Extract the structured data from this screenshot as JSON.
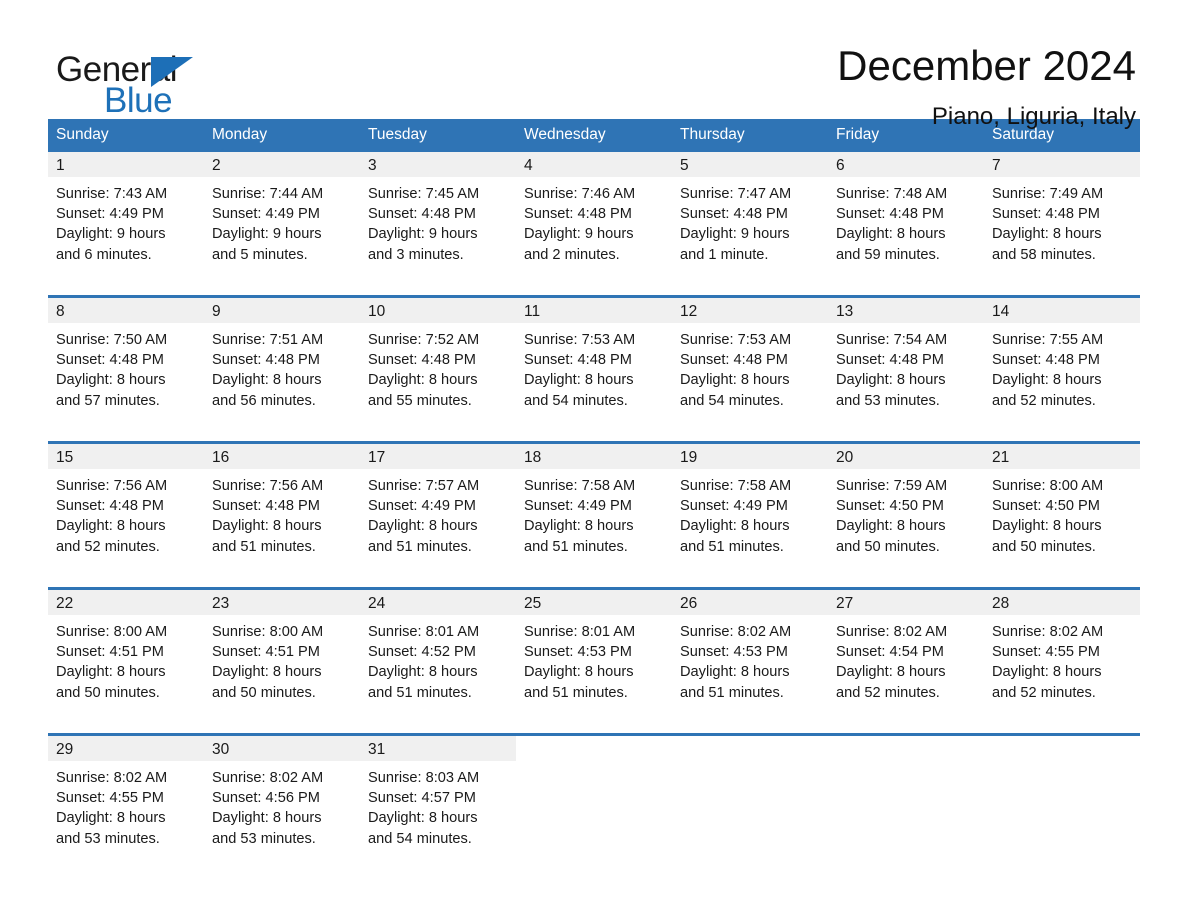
{
  "brand": {
    "name_part1": "General",
    "name_part2": "Blue",
    "triangle_icon": "triangle-icon",
    "accent_color": "#1d6fb7"
  },
  "header": {
    "title": "December 2024",
    "location": "Piano, Liguria, Italy"
  },
  "calendar": {
    "header_bg": "#2f74b5",
    "daynum_bg": "#f0f0f0",
    "weekdays": [
      "Sunday",
      "Monday",
      "Tuesday",
      "Wednesday",
      "Thursday",
      "Friday",
      "Saturday"
    ],
    "weeks": [
      [
        {
          "day": "1",
          "sunrise": "Sunrise: 7:43 AM",
          "sunset": "Sunset: 4:49 PM",
          "daylight_line1": "Daylight: 9 hours",
          "daylight_line2": "and 6 minutes."
        },
        {
          "day": "2",
          "sunrise": "Sunrise: 7:44 AM",
          "sunset": "Sunset: 4:49 PM",
          "daylight_line1": "Daylight: 9 hours",
          "daylight_line2": "and 5 minutes."
        },
        {
          "day": "3",
          "sunrise": "Sunrise: 7:45 AM",
          "sunset": "Sunset: 4:48 PM",
          "daylight_line1": "Daylight: 9 hours",
          "daylight_line2": "and 3 minutes."
        },
        {
          "day": "4",
          "sunrise": "Sunrise: 7:46 AM",
          "sunset": "Sunset: 4:48 PM",
          "daylight_line1": "Daylight: 9 hours",
          "daylight_line2": "and 2 minutes."
        },
        {
          "day": "5",
          "sunrise": "Sunrise: 7:47 AM",
          "sunset": "Sunset: 4:48 PM",
          "daylight_line1": "Daylight: 9 hours",
          "daylight_line2": "and 1 minute."
        },
        {
          "day": "6",
          "sunrise": "Sunrise: 7:48 AM",
          "sunset": "Sunset: 4:48 PM",
          "daylight_line1": "Daylight: 8 hours",
          "daylight_line2": "and 59 minutes."
        },
        {
          "day": "7",
          "sunrise": "Sunrise: 7:49 AM",
          "sunset": "Sunset: 4:48 PM",
          "daylight_line1": "Daylight: 8 hours",
          "daylight_line2": "and 58 minutes."
        }
      ],
      [
        {
          "day": "8",
          "sunrise": "Sunrise: 7:50 AM",
          "sunset": "Sunset: 4:48 PM",
          "daylight_line1": "Daylight: 8 hours",
          "daylight_line2": "and 57 minutes."
        },
        {
          "day": "9",
          "sunrise": "Sunrise: 7:51 AM",
          "sunset": "Sunset: 4:48 PM",
          "daylight_line1": "Daylight: 8 hours",
          "daylight_line2": "and 56 minutes."
        },
        {
          "day": "10",
          "sunrise": "Sunrise: 7:52 AM",
          "sunset": "Sunset: 4:48 PM",
          "daylight_line1": "Daylight: 8 hours",
          "daylight_line2": "and 55 minutes."
        },
        {
          "day": "11",
          "sunrise": "Sunrise: 7:53 AM",
          "sunset": "Sunset: 4:48 PM",
          "daylight_line1": "Daylight: 8 hours",
          "daylight_line2": "and 54 minutes."
        },
        {
          "day": "12",
          "sunrise": "Sunrise: 7:53 AM",
          "sunset": "Sunset: 4:48 PM",
          "daylight_line1": "Daylight: 8 hours",
          "daylight_line2": "and 54 minutes."
        },
        {
          "day": "13",
          "sunrise": "Sunrise: 7:54 AM",
          "sunset": "Sunset: 4:48 PM",
          "daylight_line1": "Daylight: 8 hours",
          "daylight_line2": "and 53 minutes."
        },
        {
          "day": "14",
          "sunrise": "Sunrise: 7:55 AM",
          "sunset": "Sunset: 4:48 PM",
          "daylight_line1": "Daylight: 8 hours",
          "daylight_line2": "and 52 minutes."
        }
      ],
      [
        {
          "day": "15",
          "sunrise": "Sunrise: 7:56 AM",
          "sunset": "Sunset: 4:48 PM",
          "daylight_line1": "Daylight: 8 hours",
          "daylight_line2": "and 52 minutes."
        },
        {
          "day": "16",
          "sunrise": "Sunrise: 7:56 AM",
          "sunset": "Sunset: 4:48 PM",
          "daylight_line1": "Daylight: 8 hours",
          "daylight_line2": "and 51 minutes."
        },
        {
          "day": "17",
          "sunrise": "Sunrise: 7:57 AM",
          "sunset": "Sunset: 4:49 PM",
          "daylight_line1": "Daylight: 8 hours",
          "daylight_line2": "and 51 minutes."
        },
        {
          "day": "18",
          "sunrise": "Sunrise: 7:58 AM",
          "sunset": "Sunset: 4:49 PM",
          "daylight_line1": "Daylight: 8 hours",
          "daylight_line2": "and 51 minutes."
        },
        {
          "day": "19",
          "sunrise": "Sunrise: 7:58 AM",
          "sunset": "Sunset: 4:49 PM",
          "daylight_line1": "Daylight: 8 hours",
          "daylight_line2": "and 51 minutes."
        },
        {
          "day": "20",
          "sunrise": "Sunrise: 7:59 AM",
          "sunset": "Sunset: 4:50 PM",
          "daylight_line1": "Daylight: 8 hours",
          "daylight_line2": "and 50 minutes."
        },
        {
          "day": "21",
          "sunrise": "Sunrise: 8:00 AM",
          "sunset": "Sunset: 4:50 PM",
          "daylight_line1": "Daylight: 8 hours",
          "daylight_line2": "and 50 minutes."
        }
      ],
      [
        {
          "day": "22",
          "sunrise": "Sunrise: 8:00 AM",
          "sunset": "Sunset: 4:51 PM",
          "daylight_line1": "Daylight: 8 hours",
          "daylight_line2": "and 50 minutes."
        },
        {
          "day": "23",
          "sunrise": "Sunrise: 8:00 AM",
          "sunset": "Sunset: 4:51 PM",
          "daylight_line1": "Daylight: 8 hours",
          "daylight_line2": "and 50 minutes."
        },
        {
          "day": "24",
          "sunrise": "Sunrise: 8:01 AM",
          "sunset": "Sunset: 4:52 PM",
          "daylight_line1": "Daylight: 8 hours",
          "daylight_line2": "and 51 minutes."
        },
        {
          "day": "25",
          "sunrise": "Sunrise: 8:01 AM",
          "sunset": "Sunset: 4:53 PM",
          "daylight_line1": "Daylight: 8 hours",
          "daylight_line2": "and 51 minutes."
        },
        {
          "day": "26",
          "sunrise": "Sunrise: 8:02 AM",
          "sunset": "Sunset: 4:53 PM",
          "daylight_line1": "Daylight: 8 hours",
          "daylight_line2": "and 51 minutes."
        },
        {
          "day": "27",
          "sunrise": "Sunrise: 8:02 AM",
          "sunset": "Sunset: 4:54 PM",
          "daylight_line1": "Daylight: 8 hours",
          "daylight_line2": "and 52 minutes."
        },
        {
          "day": "28",
          "sunrise": "Sunrise: 8:02 AM",
          "sunset": "Sunset: 4:55 PM",
          "daylight_line1": "Daylight: 8 hours",
          "daylight_line2": "and 52 minutes."
        }
      ],
      [
        {
          "day": "29",
          "sunrise": "Sunrise: 8:02 AM",
          "sunset": "Sunset: 4:55 PM",
          "daylight_line1": "Daylight: 8 hours",
          "daylight_line2": "and 53 minutes."
        },
        {
          "day": "30",
          "sunrise": "Sunrise: 8:02 AM",
          "sunset": "Sunset: 4:56 PM",
          "daylight_line1": "Daylight: 8 hours",
          "daylight_line2": "and 53 minutes."
        },
        {
          "day": "31",
          "sunrise": "Sunrise: 8:03 AM",
          "sunset": "Sunset: 4:57 PM",
          "daylight_line1": "Daylight: 8 hours",
          "daylight_line2": "and 54 minutes."
        },
        {
          "day": "",
          "sunrise": "",
          "sunset": "",
          "daylight_line1": "",
          "daylight_line2": ""
        },
        {
          "day": "",
          "sunrise": "",
          "sunset": "",
          "daylight_line1": "",
          "daylight_line2": ""
        },
        {
          "day": "",
          "sunrise": "",
          "sunset": "",
          "daylight_line1": "",
          "daylight_line2": ""
        },
        {
          "day": "",
          "sunrise": "",
          "sunset": "",
          "daylight_line1": "",
          "daylight_line2": ""
        }
      ]
    ]
  }
}
